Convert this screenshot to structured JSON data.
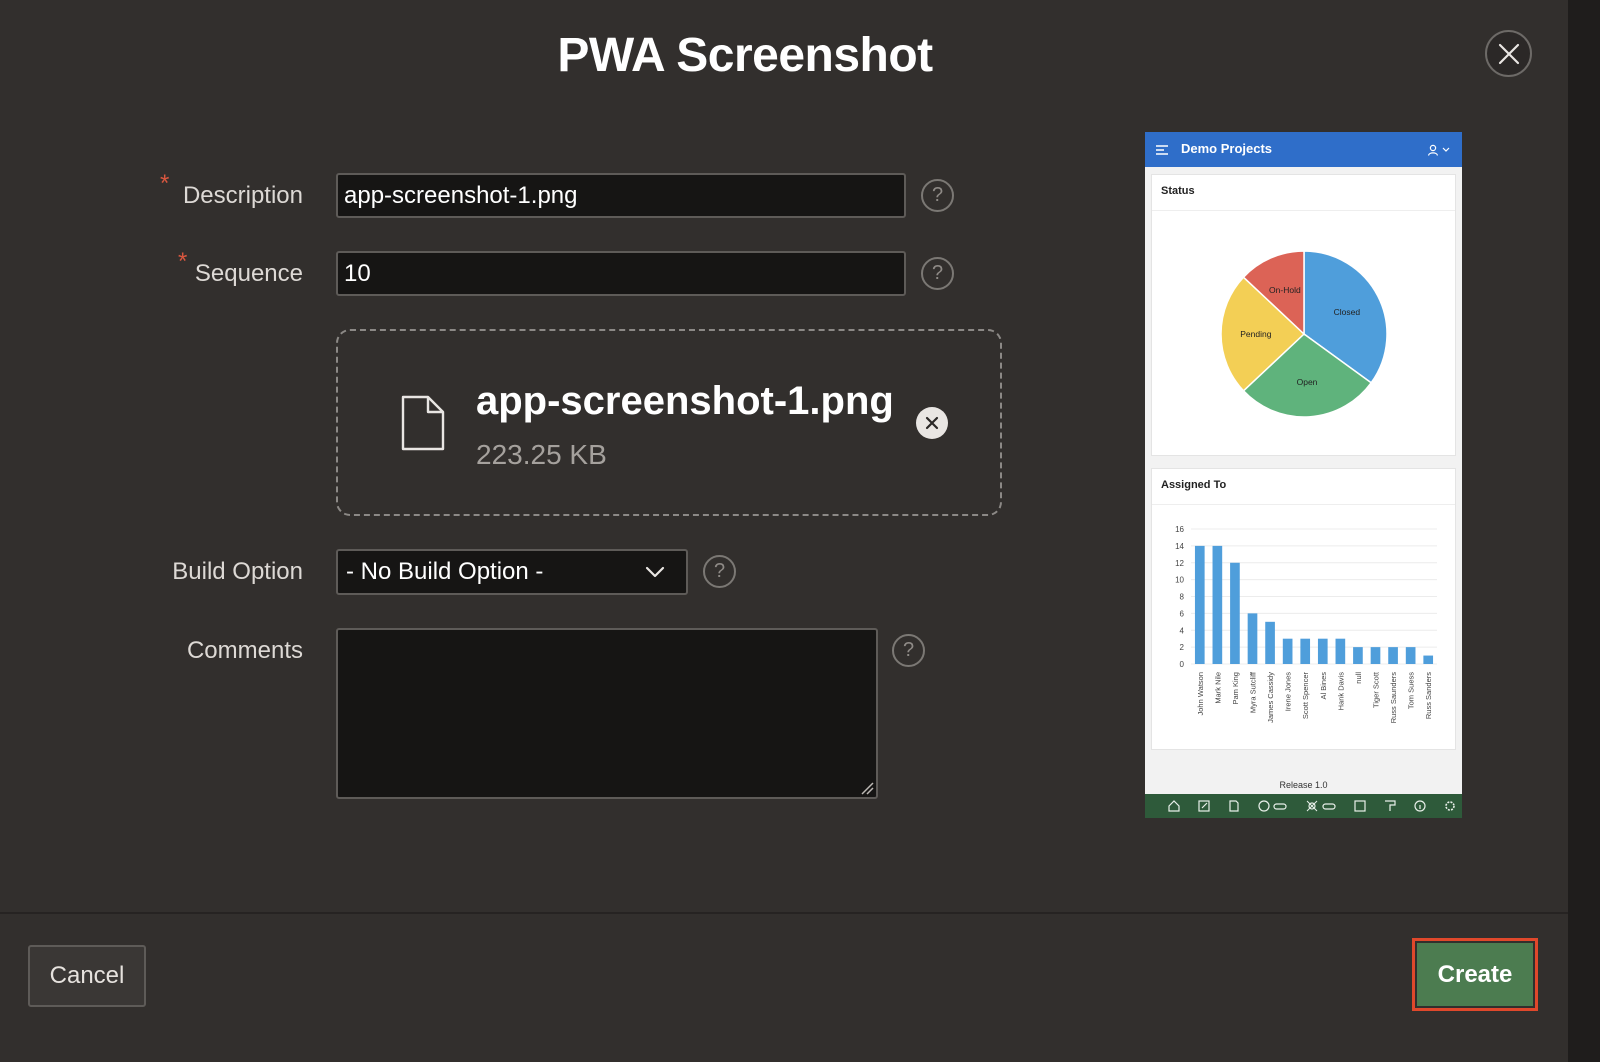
{
  "dialog": {
    "title": "PWA Screenshot"
  },
  "form": {
    "description": {
      "label": "Description",
      "value": "app-screenshot-1.png",
      "help": "?"
    },
    "sequence": {
      "label": "Sequence",
      "value": "10",
      "help": "?"
    },
    "upload": {
      "file_name": "app-screenshot-1.png",
      "file_size": "223.25 KB"
    },
    "build_option": {
      "label": "Build Option",
      "selected": "- No Build Option -",
      "help": "?"
    },
    "comments": {
      "label": "Comments",
      "value": "",
      "help": "?"
    },
    "required_mark": "*"
  },
  "preview": {
    "app_title": "Demo Projects",
    "status_card": {
      "title": "Status",
      "slices": [
        {
          "label": "Closed",
          "value": 35,
          "color": "#4f9edb"
        },
        {
          "label": "Open",
          "value": 28,
          "color": "#5fb37c"
        },
        {
          "label": "Pending",
          "value": 24,
          "color": "#f3cf55"
        },
        {
          "label": "On-Hold",
          "value": 13,
          "color": "#dc6356"
        }
      ]
    },
    "assigned_card": {
      "title": "Assigned To",
      "y_ticks": [
        "0",
        "2",
        "4",
        "6",
        "8",
        "10",
        "12",
        "14",
        "16"
      ],
      "y_max": 16,
      "bar_color": "#4f9edb",
      "categories": [
        "John Watson",
        "Mark Nile",
        "Pam King",
        "Myra Sutcliff",
        "James Cassidy",
        "Irene Jones",
        "Scott Spencer",
        "Al Bines",
        "Hank Davis",
        "null",
        "Tiger Scott",
        "Russ Saunders",
        "Tom Suess",
        "Russ Sanders"
      ],
      "values": [
        14,
        14,
        12,
        6,
        5,
        3,
        3,
        3,
        3,
        2,
        2,
        2,
        2,
        1
      ]
    },
    "release": "Release 1.0"
  },
  "buttons": {
    "cancel": "Cancel",
    "create": "Create"
  },
  "colors": {
    "background": "#322f2d",
    "primary": "#4c7c50",
    "required": "#d9573f",
    "highlight": "#e0482b"
  }
}
